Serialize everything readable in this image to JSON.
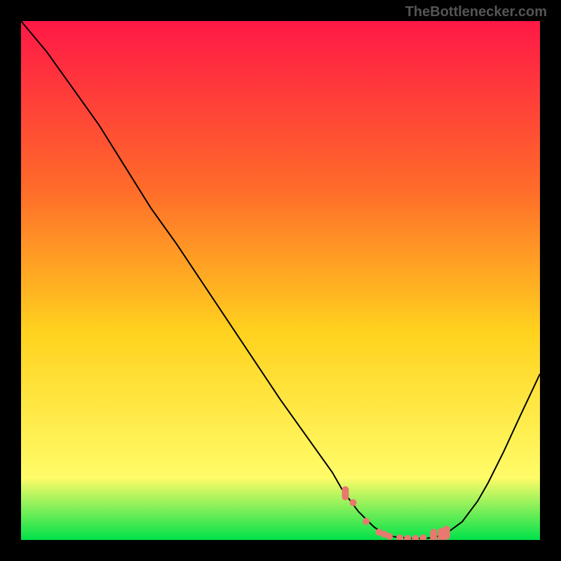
{
  "watermark": "TheBottlenecker.com",
  "chart_data": {
    "type": "line",
    "title": "",
    "xlabel": "",
    "ylabel": "",
    "xlim": [
      0,
      100
    ],
    "ylim": [
      0,
      100
    ],
    "background_gradient": {
      "top": "#ff1846",
      "mid_upper": "#ff6a2a",
      "mid": "#ffd21e",
      "mid_lower": "#fffc68",
      "bottom": "#00e24a"
    },
    "curve": {
      "name": "bottleneck-curve",
      "color": "#000000",
      "x": [
        0,
        5,
        10,
        15,
        20,
        25,
        30,
        35,
        40,
        45,
        50,
        55,
        60,
        62,
        65,
        68,
        70,
        72,
        75,
        78,
        80,
        82,
        85,
        88,
        90,
        93,
        96,
        100
      ],
      "y": [
        100,
        94,
        87,
        80,
        72,
        64,
        57,
        49.5,
        42,
        34.5,
        27,
        20,
        13,
        9.5,
        5.5,
        2.5,
        1.2,
        0.6,
        0.3,
        0.3,
        0.6,
        1.3,
        3.5,
        7.5,
        11,
        17,
        23.5,
        32
      ]
    },
    "markers": {
      "color": "#e8796f",
      "points_dashes": [
        {
          "x": 62.5,
          "y": 9
        },
        {
          "x": 79.5,
          "y": 0.8
        },
        {
          "x": 81.0,
          "y": 1.0
        },
        {
          "x": 82.0,
          "y": 1.4
        }
      ],
      "points_dots": [
        {
          "x": 64.0,
          "y": 7.2
        },
        {
          "x": 66.5,
          "y": 3.6
        },
        {
          "x": 69.0,
          "y": 1.5
        },
        {
          "x": 70.0,
          "y": 1.1
        },
        {
          "x": 71.0,
          "y": 0.7
        },
        {
          "x": 73.0,
          "y": 0.4
        },
        {
          "x": 74.5,
          "y": 0.3
        },
        {
          "x": 76.0,
          "y": 0.3
        },
        {
          "x": 77.5,
          "y": 0.4
        }
      ]
    }
  }
}
